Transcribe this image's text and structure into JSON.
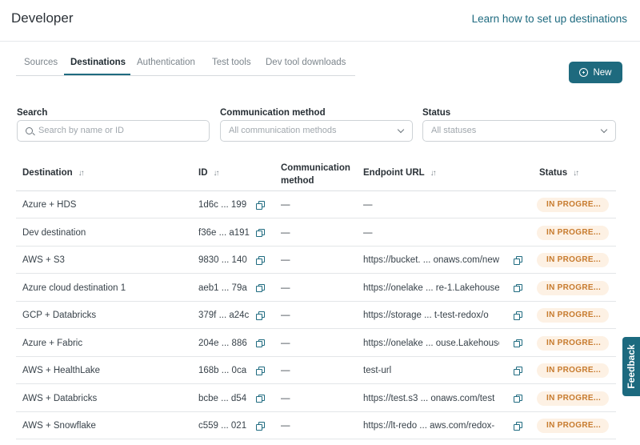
{
  "header": {
    "title": "Developer",
    "learn_link": "Learn how to set up destinations"
  },
  "tabs": [
    {
      "label": "Sources",
      "active": false
    },
    {
      "label": "Destinations",
      "active": true
    },
    {
      "label": "Authentication",
      "active": false
    },
    {
      "label": "Test tools",
      "active": false
    },
    {
      "label": "Dev tool downloads",
      "active": false
    }
  ],
  "new_button": {
    "label": "New",
    "icon": "plus-circle-icon"
  },
  "filters": {
    "search": {
      "label": "Search",
      "placeholder": "Search by name or ID",
      "icon": "search-icon"
    },
    "communication_method": {
      "label": "Communication method",
      "placeholder": "All communication methods"
    },
    "status": {
      "label": "Status",
      "placeholder": "All statuses"
    }
  },
  "table": {
    "headers": {
      "destination": "Destination",
      "id": "ID",
      "communication_line1": "Communication",
      "communication_line2": "method",
      "endpoint": "Endpoint URL",
      "status": "Status"
    },
    "sort_icon": "↓↑",
    "rows": [
      {
        "destination": "Azure + HDS",
        "id": "1d6c ... 199",
        "communication": "—",
        "endpoint": "—",
        "endpoint_copy": false,
        "status": "IN PROGRE..."
      },
      {
        "destination": "Dev destination",
        "id": "f36e ... a191",
        "communication": "—",
        "endpoint": "—",
        "endpoint_copy": false,
        "status": "IN PROGRE..."
      },
      {
        "destination": "AWS + S3",
        "id": "9830 ... 140",
        "communication": "—",
        "endpoint": "https://bucket. ... onaws.com/new-",
        "endpoint_copy": true,
        "status": "IN PROGRE..."
      },
      {
        "destination": "Azure cloud destination 1",
        "id": "aeb1 ... 79a",
        "communication": "—",
        "endpoint": "https://onelake ... re-1.Lakehouse",
        "endpoint_copy": true,
        "status": "IN PROGRE..."
      },
      {
        "destination": "GCP + Databricks",
        "id": "379f ... a24c",
        "communication": "—",
        "endpoint": "https://storage ... t-test-redox/o",
        "endpoint_copy": true,
        "status": "IN PROGRE..."
      },
      {
        "destination": "Azure + Fabric",
        "id": "204e ... 886",
        "communication": "—",
        "endpoint": "https://onelake ... ouse.Lakehouse",
        "endpoint_copy": true,
        "status": "IN PROGRE..."
      },
      {
        "destination": "AWS + HealthLake",
        "id": "168b ... 0ca",
        "communication": "—",
        "endpoint": "test-url",
        "endpoint_copy": true,
        "status": "IN PROGRE..."
      },
      {
        "destination": "AWS + Databricks",
        "id": "bcbe ... d54",
        "communication": "—",
        "endpoint": "https://test.s3 ... onaws.com/test",
        "endpoint_copy": true,
        "status": "IN PROGRE..."
      },
      {
        "destination": "AWS + Snowflake",
        "id": "c559 ... 021",
        "communication": "—",
        "endpoint": "https://lt-redo ... aws.com/redox-",
        "endpoint_copy": true,
        "status": "IN PROGRE..."
      }
    ]
  },
  "feedback": {
    "label": "Feedback"
  },
  "colors": {
    "accent": "#1e6a7e",
    "status_bg": "#fdf1e4",
    "status_text": "#c77b2e"
  }
}
